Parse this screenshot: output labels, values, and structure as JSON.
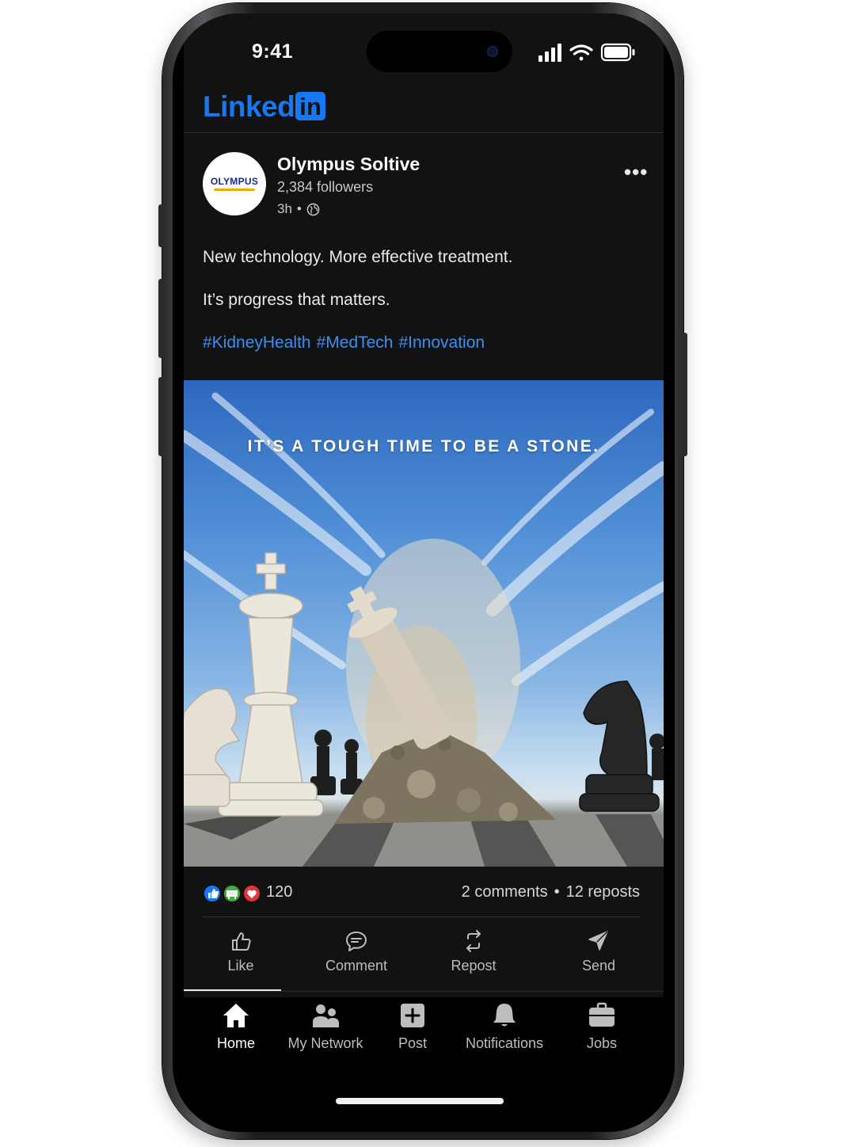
{
  "status_bar": {
    "time": "9:41"
  },
  "header": {
    "logo_word": "Linked",
    "logo_box": "in"
  },
  "post": {
    "author": "Olympus Soltive",
    "avatar_logo": "OLYMPUS",
    "followers": "2,384 followers",
    "time": "3h",
    "separator": "•",
    "menu": "•••",
    "line1": "New technology. More effective treatment.",
    "line2": "It’s progress that matters.",
    "hashtags": [
      "#KidneyHealth",
      "#MedTech",
      "#Innovation"
    ],
    "image_headline": "IT’S A TOUGH TIME TO BE A STONE."
  },
  "engagement": {
    "reaction_count": "120",
    "comments": "2 comments",
    "separator": "•",
    "reposts": "12 reposts"
  },
  "actions": {
    "like": "Like",
    "comment": "Comment",
    "repost": "Repost",
    "send": "Send"
  },
  "nav": {
    "home": "Home",
    "network": "My Network",
    "post": "Post",
    "notifications": "Notifications",
    "jobs": "Jobs"
  },
  "colors": {
    "brand": "#1877f2",
    "hashtag": "#3b8ff0",
    "background": "#121212",
    "like_reaction": "#1877f2",
    "celebrate_reaction": "#3fae3f",
    "love_reaction": "#e0333a"
  },
  "icons": [
    "globe-icon",
    "more-options-icon",
    "thumbs-up-icon",
    "comment-icon",
    "repost-icon",
    "send-icon",
    "home-icon",
    "network-icon",
    "plus-square-icon",
    "bell-icon",
    "briefcase-icon",
    "signal-icon",
    "wifi-icon",
    "battery-icon"
  ]
}
